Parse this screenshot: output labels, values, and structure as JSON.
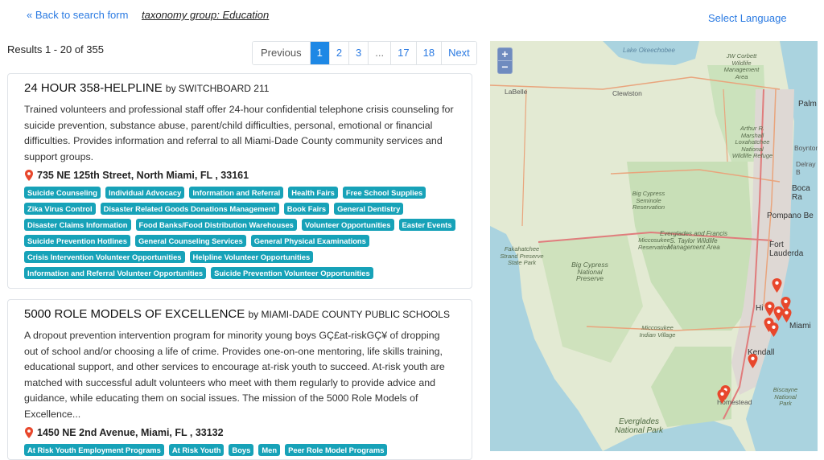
{
  "header": {
    "back_link": "« Back to search form",
    "taxonomy": "taxonomy group: Education",
    "select_language": "Select Language"
  },
  "results": {
    "count_text": "Results 1 - 20 of 355"
  },
  "pagination": {
    "previous": "Previous",
    "pages": [
      "1",
      "2",
      "3",
      "...",
      "17",
      "18"
    ],
    "active": "1",
    "next": "Next"
  },
  "cards": [
    {
      "name": "24 HOUR 358-HELPLINE",
      "by": "by SWITCHBOARD 211",
      "description": "Trained volunteers and professional staff offer 24-hour confidential telephone crisis counseling for suicide prevention, substance abuse, parent/child difficulties, personal, emotional or financial difficulties. Provides information and referral to all Miami-Dade County community services and support groups.",
      "address": "735 NE 125th Street, North Miami, FL , 33161",
      "tags": [
        "Suicide Counseling",
        "Individual Advocacy",
        "Information and Referral",
        "Health Fairs",
        "Free School Supplies",
        "Zika Virus Control",
        "Disaster Related Goods Donations Management",
        "Book Fairs",
        "General Dentistry",
        "Disaster Claims Information",
        "Food Banks/Food Distribution Warehouses",
        "Volunteer Opportunities",
        "Easter Events",
        "Suicide Prevention Hotlines",
        "General Counseling Services",
        "General Physical Examinations",
        "Crisis Intervention Volunteer Opportunities",
        "Helpline Volunteer Opportunities",
        "Information and Referral Volunteer Opportunities",
        "Suicide Prevention Volunteer Opportunities"
      ]
    },
    {
      "name": "5000 ROLE MODELS OF EXCELLENCE",
      "by": "by MIAMI-DADE COUNTY PUBLIC SCHOOLS",
      "description": "A dropout prevention intervention program for minority young boys GÇ£at-riskGÇ¥ of dropping out of school and/or choosing a life of crime. Provides one-on-one mentoring, life skills training, educational support, and other services to encourage at-risk youth to succeed. At-risk youth are matched with successful adult volunteers who meet with them regularly to provide advice and guidance, while educating them on social issues. The mission of the 5000 Role Models of Excellence...",
      "address": "1450 NE 2nd Avenue, Miami, FL , 33132",
      "tags": [
        "At Risk Youth Employment Programs",
        "At Risk Youth",
        "Boys",
        "Men",
        "Peer Role Model Programs"
      ]
    }
  ],
  "map": {
    "zoom_in": "+",
    "zoom_out": "−",
    "labels": {
      "lake": "Lake Okeechobee",
      "corbett": "JW Corbett Wildlife Management Area",
      "labelle": "LaBelle",
      "clewiston": "Clewiston",
      "palm": "Palm",
      "loxahatchee": "Arthur R. Marshall Loxahatchee National Wildlife Refuge",
      "boynton": "Boynton",
      "delray": "Delray B",
      "boca": "Boca Ra",
      "bigcypress_res": "Big Cypress Seminole Reservation",
      "pompano": "Pompano Be",
      "everglades_mgmt": "Everglades and Francis S. Taylor Wildlife Management Area",
      "ftl": "Fort Lauderda",
      "miccosukee_res": "Miccosukee Reservation",
      "fakahatchee": "Fakahatchee Strand Preserve State Park",
      "bigcypress_pres": "Big Cypress National Preserve",
      "hialeah": "Hi",
      "miami": "Miami",
      "miccosukee_village": "Miccosukee Indian Village",
      "kendall": "Kendall",
      "homestead": "Homestead",
      "biscayne": "Biscayne National Park",
      "everglades_np": "Everglades National Park"
    }
  },
  "colors": {
    "link": "#2a7ae2",
    "tag": "#17a2b8",
    "active_page": "#1e88e5",
    "marker": "#e8472c"
  }
}
